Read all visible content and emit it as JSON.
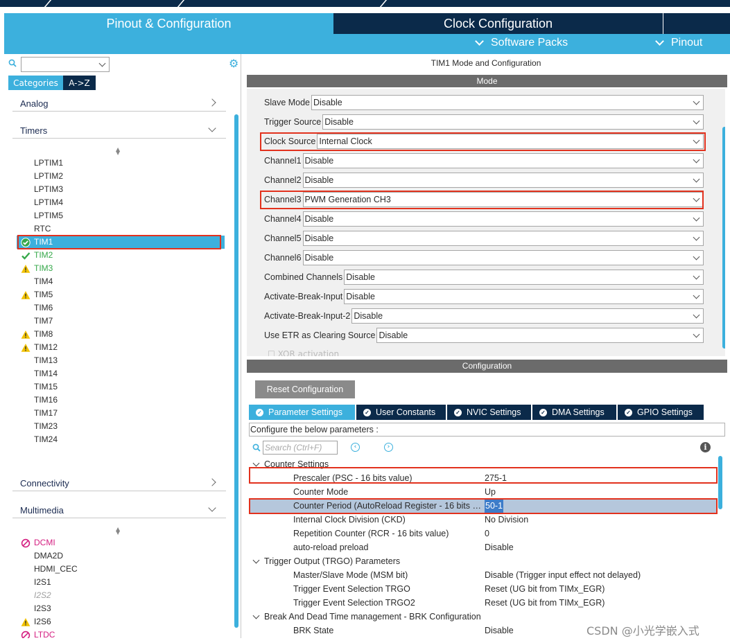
{
  "main_tabs": {
    "pinout": "Pinout & Configuration",
    "clock": "Clock Configuration"
  },
  "submenu": {
    "software_packs": "Software Packs",
    "pinout": "Pinout"
  },
  "left": {
    "cat_tabs": {
      "categories": "Categories",
      "az": "A->Z"
    },
    "categories": {
      "analog": "Analog",
      "timers": "Timers",
      "connectivity": "Connectivity",
      "multimedia": "Multimedia"
    },
    "timers": [
      {
        "label": "LPTIM1",
        "status": "none"
      },
      {
        "label": "LPTIM2",
        "status": "none"
      },
      {
        "label": "LPTIM3",
        "status": "none"
      },
      {
        "label": "LPTIM4",
        "status": "none"
      },
      {
        "label": "LPTIM5",
        "status": "none"
      },
      {
        "label": "RTC",
        "status": "none"
      },
      {
        "label": "TIM1",
        "status": "selected"
      },
      {
        "label": "TIM2",
        "status": "ok"
      },
      {
        "label": "TIM3",
        "status": "warning"
      },
      {
        "label": "TIM4",
        "status": "none"
      },
      {
        "label": "TIM5",
        "status": "warning"
      },
      {
        "label": "TIM6",
        "status": "none"
      },
      {
        "label": "TIM7",
        "status": "none"
      },
      {
        "label": "TIM8",
        "status": "warning"
      },
      {
        "label": "TIM12",
        "status": "warning"
      },
      {
        "label": "TIM13",
        "status": "none"
      },
      {
        "label": "TIM14",
        "status": "none"
      },
      {
        "label": "TIM15",
        "status": "none"
      },
      {
        "label": "TIM16",
        "status": "none"
      },
      {
        "label": "TIM17",
        "status": "none"
      },
      {
        "label": "TIM23",
        "status": "none"
      },
      {
        "label": "TIM24",
        "status": "none"
      }
    ],
    "multimedia": [
      {
        "label": "DCMI",
        "status": "blocked"
      },
      {
        "label": "DMA2D",
        "status": "none"
      },
      {
        "label": "HDMI_CEC",
        "status": "none"
      },
      {
        "label": "I2S1",
        "status": "none"
      },
      {
        "label": "I2S2",
        "status": "disabled"
      },
      {
        "label": "I2S3",
        "status": "none"
      },
      {
        "label": "I2S6",
        "status": "warning"
      },
      {
        "label": "LTDC",
        "status": "blocked"
      }
    ]
  },
  "mode": {
    "title": "TIM1 Mode and Configuration",
    "section": "Mode",
    "rows": [
      {
        "label": "Slave Mode",
        "value": "Disable"
      },
      {
        "label": "Trigger Source",
        "value": "Disable"
      },
      {
        "label": "Clock Source",
        "value": "Internal Clock"
      },
      {
        "label": "Channel1",
        "value": "Disable"
      },
      {
        "label": "Channel2",
        "value": "Disable"
      },
      {
        "label": "Channel3",
        "value": "PWM Generation CH3"
      },
      {
        "label": "Channel4",
        "value": "Disable"
      },
      {
        "label": "Channel5",
        "value": "Disable"
      },
      {
        "label": "Channel6",
        "value": "Disable"
      },
      {
        "label": "Combined Channels",
        "value": "Disable"
      },
      {
        "label": "Activate-Break-Input",
        "value": "Disable"
      },
      {
        "label": "Activate-Break-Input-2",
        "value": "Disable"
      },
      {
        "label": "Use ETR as Clearing Source",
        "value": "Disable"
      }
    ],
    "xor_label": "XOR activation"
  },
  "config": {
    "section": "Configuration",
    "reset_button": "Reset Configuration",
    "tabs": [
      "Parameter Settings",
      "User Constants",
      "NVIC Settings",
      "DMA Settings",
      "GPIO Settings"
    ],
    "hint": "Configure the below parameters :",
    "search_placeholder": "Search (Ctrl+F)",
    "params": [
      {
        "name": "Counter Settings",
        "value": "",
        "group": true
      },
      {
        "name": "Prescaler (PSC - 16 bits value)",
        "value": "275-1"
      },
      {
        "name": "Counter Mode",
        "value": "Up"
      },
      {
        "name": "Counter Period (AutoReload Register - 16 bits value)",
        "value": "50-1",
        "highlight": true
      },
      {
        "name": "Internal Clock Division (CKD)",
        "value": "No Division"
      },
      {
        "name": "Repetition Counter (RCR - 16 bits value)",
        "value": "0"
      },
      {
        "name": "auto-reload preload",
        "value": "Disable"
      },
      {
        "name": "Trigger Output (TRGO) Parameters",
        "value": "",
        "group": true
      },
      {
        "name": "Master/Slave Mode (MSM bit)",
        "value": "Disable (Trigger input effect not delayed)"
      },
      {
        "name": "Trigger Event Selection TRGO",
        "value": "Reset (UG bit from TIMx_EGR)"
      },
      {
        "name": "Trigger Event Selection TRGO2",
        "value": "Reset (UG bit from TIMx_EGR)"
      },
      {
        "name": "Break And Dead Time management - BRK Configuration",
        "value": "",
        "group": true
      },
      {
        "name": "BRK State",
        "value": "Disable"
      }
    ]
  },
  "watermark": "CSDN @小光学嵌入式",
  "colors": {
    "accent": "#3cb0dd",
    "dark": "#0b2a4a",
    "highlight_box": "#e2311d",
    "ok": "#36a84a",
    "warning": "#f2c200",
    "blocked": "#d41d80"
  }
}
